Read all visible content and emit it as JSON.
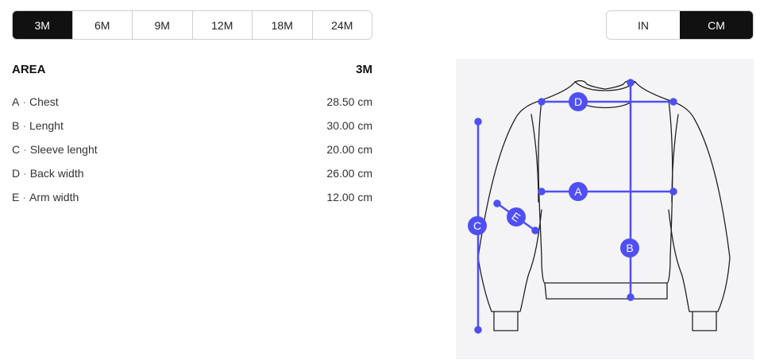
{
  "size_tabs": [
    {
      "label": "3M",
      "active": true
    },
    {
      "label": "6M",
      "active": false
    },
    {
      "label": "9M",
      "active": false
    },
    {
      "label": "12M",
      "active": false
    },
    {
      "label": "18M",
      "active": false
    },
    {
      "label": "24M",
      "active": false
    }
  ],
  "unit_tabs": [
    {
      "label": "IN",
      "active": false
    },
    {
      "label": "CM",
      "active": true
    }
  ],
  "table": {
    "area_header": "AREA",
    "size_header": "3M",
    "separator": "·",
    "rows": [
      {
        "letter": "A",
        "name": "Chest",
        "value": "28.50 cm"
      },
      {
        "letter": "B",
        "name": "Lenght",
        "value": "30.00 cm"
      },
      {
        "letter": "C",
        "name": "Sleeve lenght",
        "value": "20.00 cm"
      },
      {
        "letter": "D",
        "name": "Back width",
        "value": "26.00 cm"
      },
      {
        "letter": "E",
        "name": "Arm width",
        "value": "12.00 cm"
      }
    ]
  },
  "diagram": {
    "accent_color": "#4f4ff5",
    "labels": {
      "A": "A",
      "B": "B",
      "C": "C",
      "D": "D",
      "E": "E"
    }
  }
}
